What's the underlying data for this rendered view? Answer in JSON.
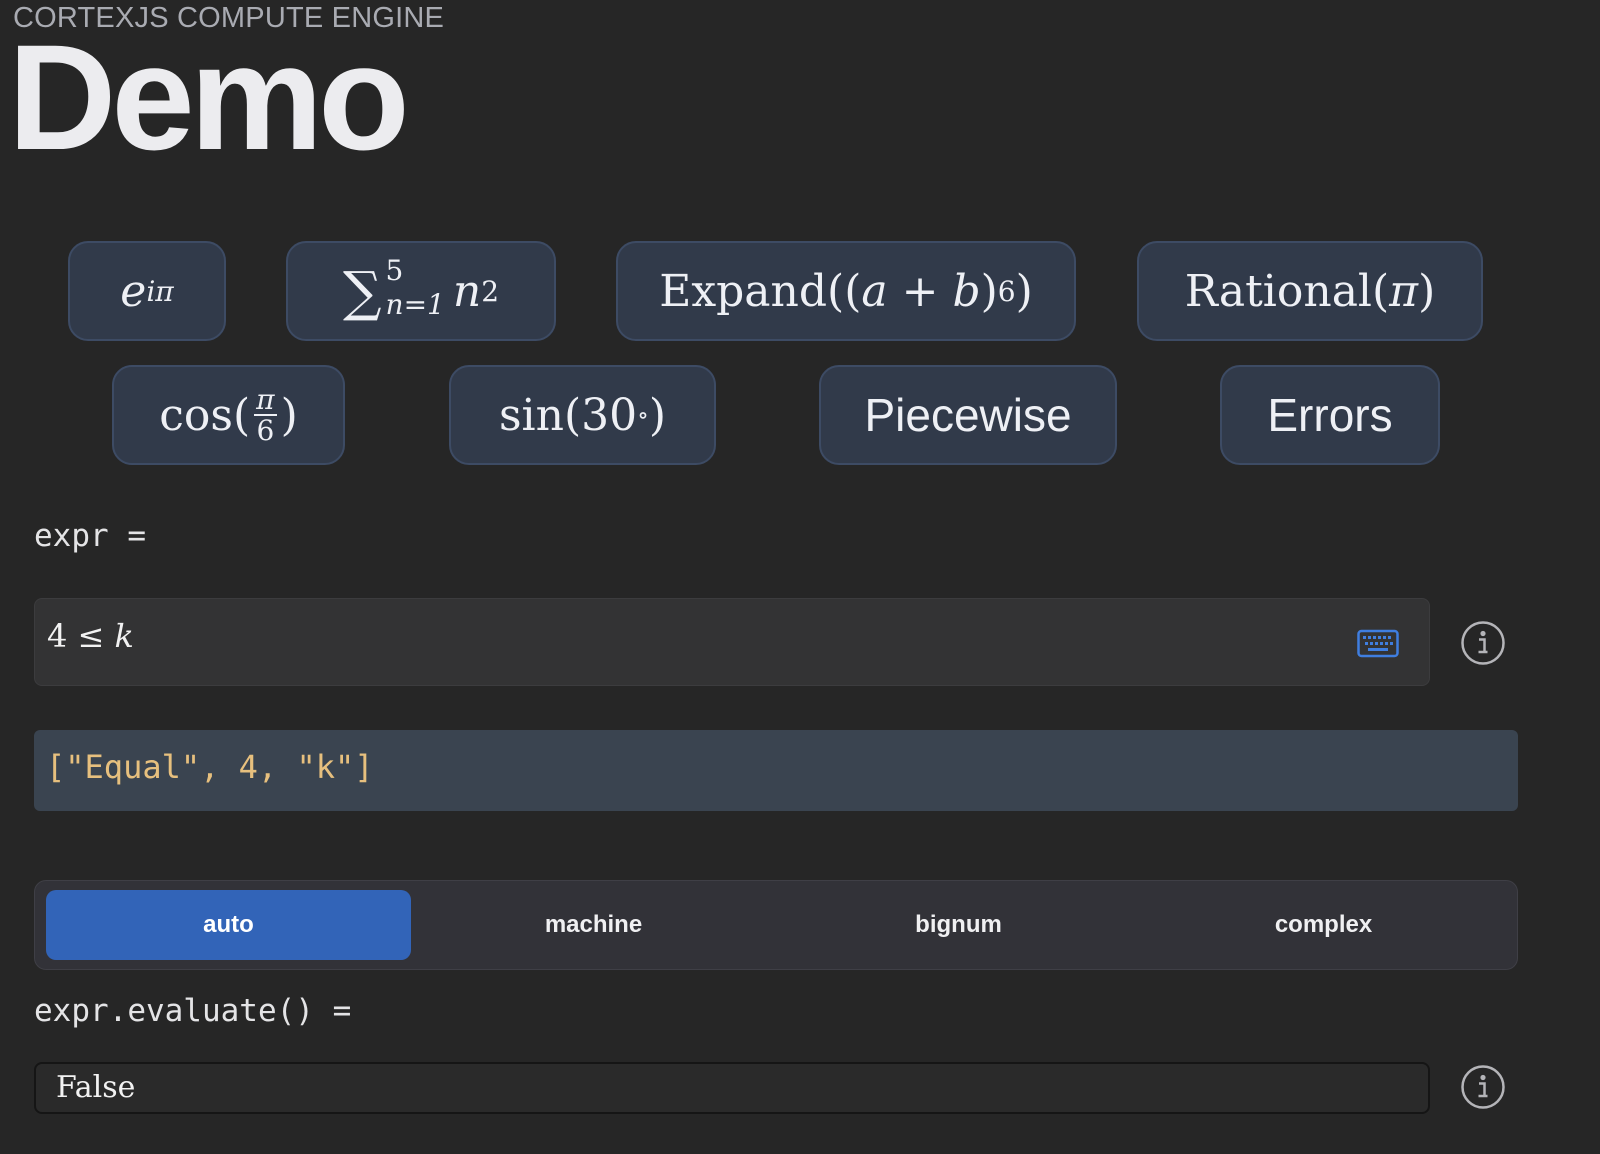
{
  "header": {
    "eyebrow": "CORTEXJS COMPUTE ENGINE",
    "title": "Demo"
  },
  "examples": {
    "euler": {
      "base": "e",
      "exponent": "iπ"
    },
    "sum": {
      "symbol": "∑",
      "upper": "5",
      "lower": "n=1",
      "term": "n",
      "power": "2"
    },
    "expand": {
      "func": "Expand((",
      "a": "a",
      "plus": " + ",
      "b": "b",
      "close": ")",
      "power": "6",
      "end": ")"
    },
    "rational": {
      "func": "Rational(",
      "arg": "π",
      "end": ")"
    },
    "cos": {
      "func": "cos(",
      "num": "π",
      "den": "6",
      "end": ")"
    },
    "sin": {
      "func": "sin(30",
      "deg": "∘",
      "end": ")"
    },
    "piecewise": "Piecewise",
    "errors": "Errors"
  },
  "expr_label": "expr =",
  "input": {
    "left": "4 ≤ ",
    "var": "k",
    "keyboard_icon": "keyboard-icon",
    "info_icon": "info-icon"
  },
  "json_output": "[\"Equal\", 4, \"k\"]",
  "numeric_modes": {
    "options": [
      "auto",
      "machine",
      "bignum",
      "complex"
    ],
    "selected": "auto"
  },
  "evaluate_label": "expr.evaluate() =",
  "result": {
    "value": "False",
    "info_icon": "info-icon"
  },
  "colors": {
    "background": "#262626",
    "button_bg": "#313a4a",
    "accent": "#3264b8",
    "json_text": "#e7c07e",
    "keyboard_icon": "#3f7ee0"
  }
}
